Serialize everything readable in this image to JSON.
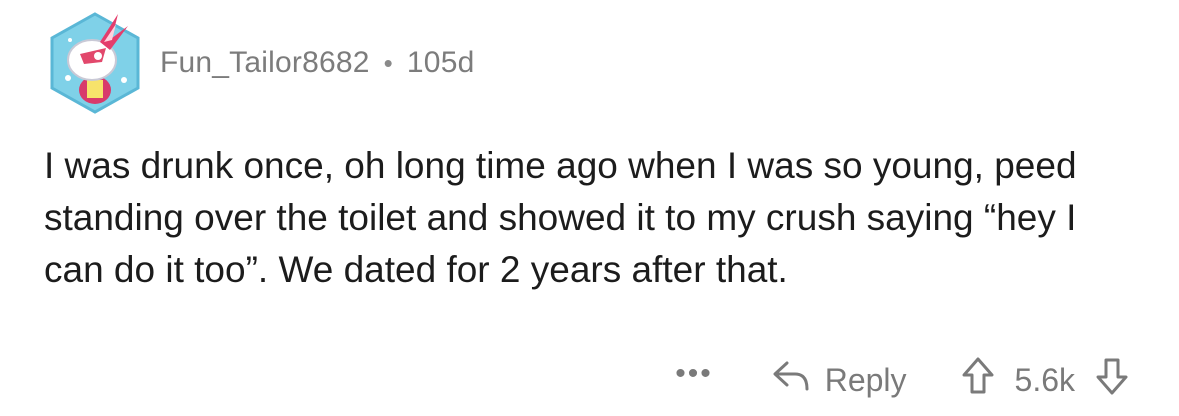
{
  "comment": {
    "author": "Fun_Tailor8682",
    "separator": "•",
    "age": "105d",
    "body": "I was drunk once, oh long time ago when I was so young, peed standing over the toilet and showed it to my crush saying “hey I can do it too”. We dated for 2 years after that."
  },
  "actions": {
    "more_label": "•••",
    "reply_label": "Reply",
    "score": "5.6k"
  },
  "icons": {
    "avatar": "snoo-avatar-icon",
    "reply": "reply-arrow-icon",
    "upvote": "upvote-arrow-icon",
    "downvote": "downvote-arrow-icon"
  },
  "colors": {
    "meta_text": "#7c7c7c",
    "body_text": "#1c1c1c",
    "avatar_bg": "#7fd1e8"
  }
}
